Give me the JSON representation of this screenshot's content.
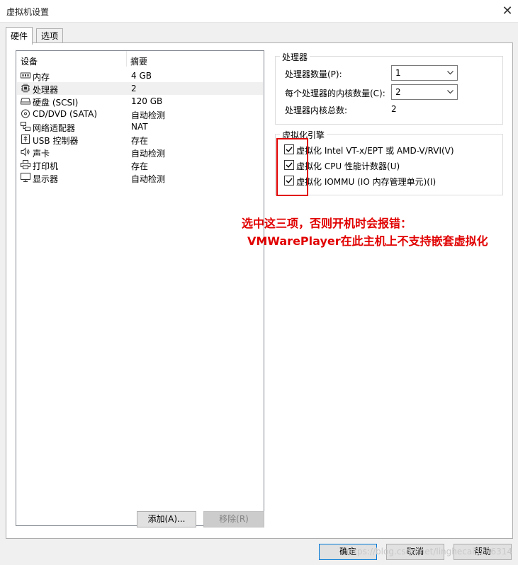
{
  "window": {
    "title": "虚拟机设置"
  },
  "tabs": [
    {
      "label": "硬件"
    },
    {
      "label": "选项"
    }
  ],
  "devices": {
    "header_device": "设备",
    "header_summary": "摘要",
    "rows": [
      {
        "name": "内存",
        "summary": "4 GB",
        "icon": "memory-icon"
      },
      {
        "name": "处理器",
        "summary": "2",
        "icon": "processor-icon"
      },
      {
        "name": "硬盘 (SCSI)",
        "summary": "120 GB",
        "icon": "hard-disk-icon"
      },
      {
        "name": "CD/DVD (SATA)",
        "summary": "自动检测",
        "icon": "cd-dvd-icon"
      },
      {
        "name": "网络适配器",
        "summary": "NAT",
        "icon": "network-adapter-icon"
      },
      {
        "name": "USB 控制器",
        "summary": "存在",
        "icon": "usb-icon"
      },
      {
        "name": "声卡",
        "summary": "自动检测",
        "icon": "speaker-icon"
      },
      {
        "name": "打印机",
        "summary": "存在",
        "icon": "printer-icon"
      },
      {
        "name": "显示器",
        "summary": "自动检测",
        "icon": "monitor-icon"
      }
    ],
    "add_button": "添加(A)...",
    "remove_button": "移除(R)"
  },
  "processor": {
    "group_title": "处理器",
    "count_label": "处理器数量(P):",
    "count_value": "1",
    "cores_label": "每个处理器的内核数量(C):",
    "cores_value": "2",
    "total_label": "处理器内核总数:",
    "total_value": "2"
  },
  "virtualization": {
    "group_title": "虚拟化引擎",
    "options": [
      {
        "label": "虚拟化 Intel VT-x/EPT 或 AMD-V/RVI(V)",
        "checked": true
      },
      {
        "label": "虚拟化 CPU 性能计数器(U)",
        "checked": true
      },
      {
        "label": "虚拟化 IOMMU (IO 内存管理单元)(I)",
        "checked": true
      }
    ]
  },
  "annotation": {
    "line1": "选中这三项，否则开机时会报错：",
    "line2": "VMWarePlayer在此主机上不支持嵌套虚拟化",
    "color": "#e10000"
  },
  "footer": {
    "ok": "确定",
    "cancel": "取消",
    "help": "帮助",
    "watermark": "https://blog.csdn.net/lingheсai5236314"
  }
}
